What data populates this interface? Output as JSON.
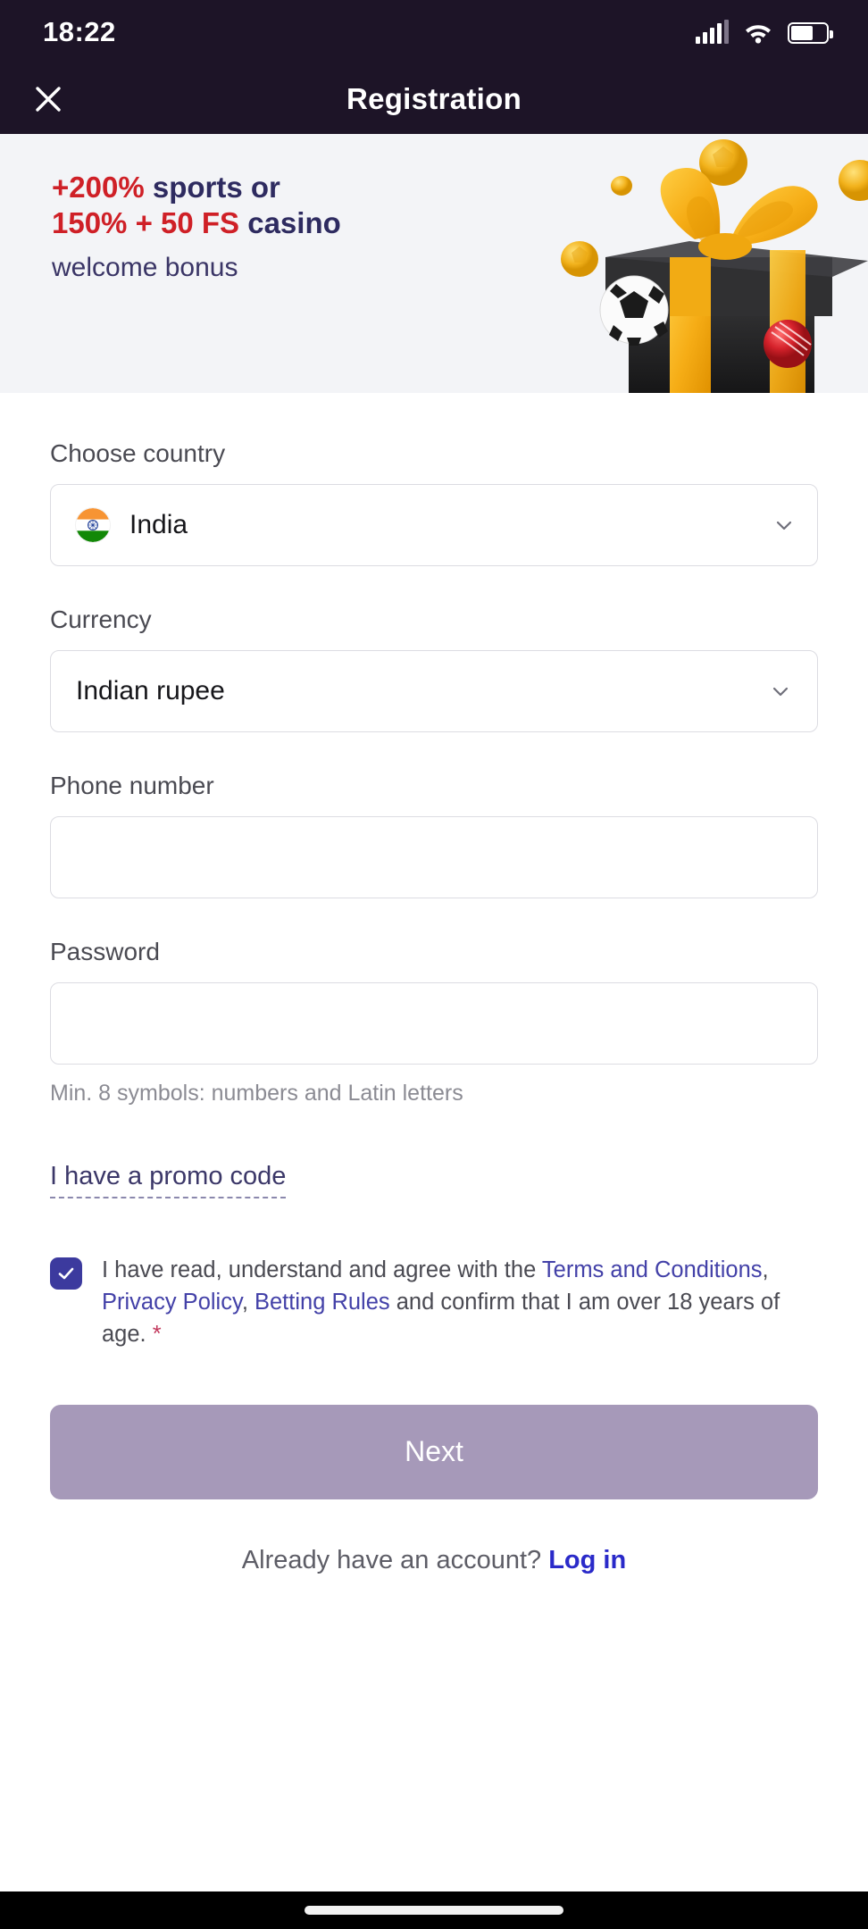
{
  "status_bar": {
    "time": "18:22",
    "signal_icon": "signal-bars-icon",
    "wifi_icon": "wifi-icon",
    "battery_icon": "battery-icon"
  },
  "header": {
    "title": "Registration",
    "close_icon": "close-icon"
  },
  "banner": {
    "line1_highlight": "+200%",
    "line1_rest": " sports or",
    "line2_highlight": "150% + 50 FS",
    "line2_rest": " casino",
    "subline": "welcome bonus",
    "art_icon": "gift-box-icon",
    "colors": {
      "background": "#f3f4f7",
      "highlight": "#cf2027",
      "text": "#2e2b60"
    }
  },
  "form": {
    "country": {
      "label": "Choose country",
      "value": "India",
      "flag_icon": "india-flag-icon",
      "chevron_icon": "chevron-down-icon"
    },
    "currency": {
      "label": "Currency",
      "value": "Indian rupee",
      "chevron_icon": "chevron-down-icon"
    },
    "phone": {
      "label": "Phone number",
      "value": "",
      "placeholder": ""
    },
    "password": {
      "label": "Password",
      "value": "",
      "placeholder": "",
      "hint": "Min. 8 symbols: numbers and Latin letters"
    },
    "promo_link": "I have a promo code"
  },
  "terms": {
    "checked": true,
    "check_icon": "check-icon",
    "part1": "I have read, understand and agree with the ",
    "link1": "Terms and Conditions",
    "sep1": ", ",
    "link2": "Privacy Policy",
    "sep2": ", ",
    "link3": "Betting Rules",
    "part2": " and confirm that I am over 18 years of age. ",
    "required_mark": "*",
    "checkbox_color": "#3c3a9e",
    "link_color": "#4341a8"
  },
  "actions": {
    "next_label": "Next",
    "next_color": "#a699b9",
    "login_prompt": "Already have an account? ",
    "login_link": "Log in",
    "login_link_color": "#2a2ac9"
  },
  "home_indicator": {
    "icon": "home-indicator-bar"
  }
}
